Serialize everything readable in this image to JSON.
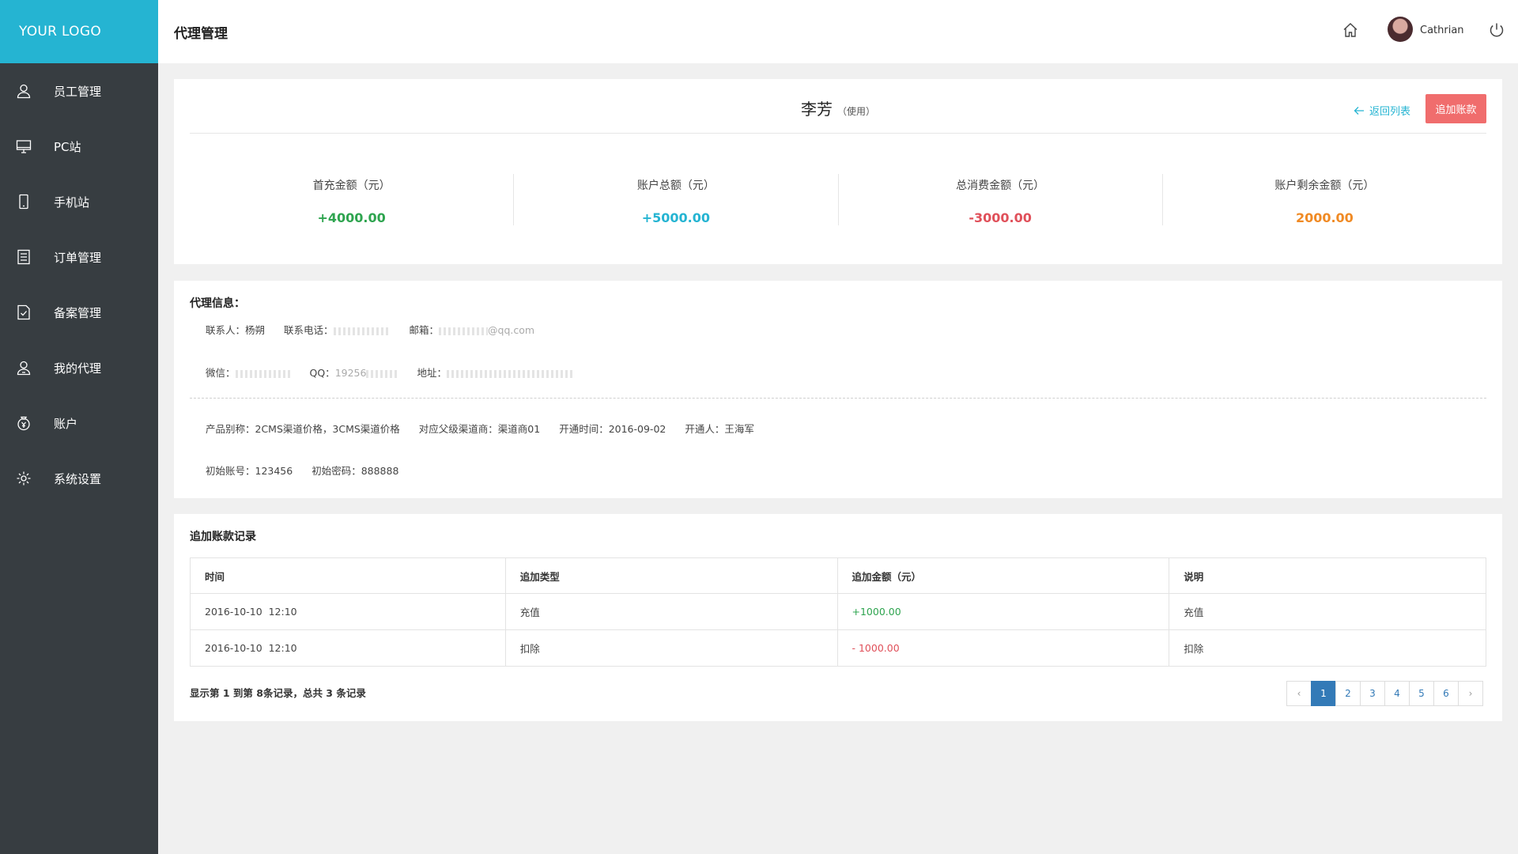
{
  "app": {
    "logo": "YOUR LOGO",
    "page_title": "代理管理"
  },
  "sidebar": {
    "items": [
      {
        "label": "员工管理",
        "icon": "user-icon"
      },
      {
        "label": "PC站",
        "icon": "monitor-icon"
      },
      {
        "label": "手机站",
        "icon": "phone-icon"
      },
      {
        "label": "订单管理",
        "icon": "document-icon"
      },
      {
        "label": "备案管理",
        "icon": "file-check-icon"
      },
      {
        "label": "我的代理",
        "icon": "agent-icon"
      },
      {
        "label": "账户",
        "icon": "money-bag-icon"
      },
      {
        "label": "系统设置",
        "icon": "gear-icon"
      }
    ]
  },
  "header": {
    "user_name": "Cathrian"
  },
  "agent": {
    "name": "李芳",
    "status": "（使用）",
    "back_label": "返回列表",
    "add_button": "追加账款"
  },
  "stats": [
    {
      "label": "首充金额（元）",
      "value": "+4000.00",
      "color": "#2ea44f"
    },
    {
      "label": "账户总额（元）",
      "value": "+5000.00",
      "color": "#25b4d2"
    },
    {
      "label": "总消费金额（元）",
      "value": "-3000.00",
      "color": "#e0505a"
    },
    {
      "label": "账户剩余金额（元）",
      "value": "2000.00",
      "color": "#f08a24"
    }
  ],
  "agent_info": {
    "title": "代理信息：",
    "contact": "联系人：杨朔",
    "phone_label": "联系电话：",
    "email_label": "邮箱：",
    "email_suffix": "@qq.com",
    "wechat_label": "微信：",
    "qq_label": "QQ：",
    "qq_prefix": "19256",
    "address_label": "地址：",
    "product_alias": "产品别称：2CMS渠道价格，3CMS渠道价格",
    "parent_channel": "对应父级渠道商：渠道商01",
    "open_time": "开通时间：2016-09-02",
    "opener": "开通人：王海军",
    "init_account": "初始账号：123456",
    "init_password": "初始密码：888888"
  },
  "records": {
    "title": "追加账款记录",
    "columns": [
      "时间",
      "追加类型",
      "追加金额（元）",
      "说明"
    ],
    "rows": [
      {
        "time": "2016-10-10  12:10",
        "type": "充值",
        "amount": "+1000.00",
        "note": "充值",
        "amount_color": "#2ea44f"
      },
      {
        "time": "2016-10-10  12:10",
        "type": "扣除",
        "amount": "- 1000.00",
        "note": "扣除",
        "amount_color": "#e0505a"
      }
    ],
    "summary": "显示第 1 到第 8条记录，总共 3 条记录",
    "pages": [
      "‹",
      "1",
      "2",
      "3",
      "4",
      "5",
      "6",
      "›"
    ],
    "current_page": "1"
  }
}
